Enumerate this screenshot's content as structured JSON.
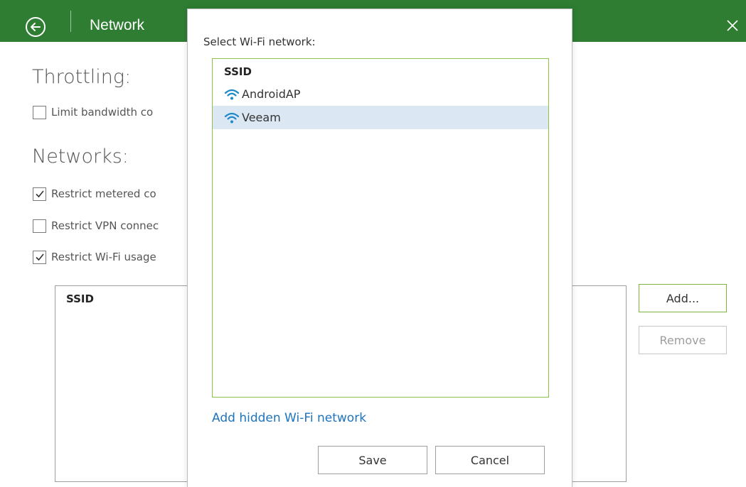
{
  "colors": {
    "header_bg": "#2e7d32",
    "accent_border": "#8bc34a",
    "selection": "#dbe8f3",
    "link": "#1e73be",
    "wifi_icon": "#1e88c9"
  },
  "header": {
    "back_icon": "arrow-left-circle-icon",
    "title": "Network",
    "close_icon": "close-icon"
  },
  "settings": {
    "throttling_title": "Throttling:",
    "limit_bandwidth_label": "Limit bandwidth co",
    "limit_bandwidth_checked": false,
    "networks_title": "Networks:",
    "restrict_metered_label": "Restrict metered co",
    "restrict_metered_checked": true,
    "restrict_vpn_label": "Restrict VPN connec",
    "restrict_vpn_checked": false,
    "restrict_wifi_label": "Restrict Wi-Fi usage",
    "restrict_wifi_checked": true,
    "ssid_column": "SSID",
    "add_button": "Add...",
    "remove_button": "Remove"
  },
  "dialog": {
    "select_label": "Select Wi-Fi network:",
    "list_header": "SSID",
    "networks": [
      {
        "name": "AndroidAP",
        "icon": "wifi-icon",
        "selected": false
      },
      {
        "name": "Veeam",
        "icon": "wifi-icon",
        "selected": true
      }
    ],
    "add_hidden_link": "Add hidden Wi-Fi network",
    "save_button": "Save",
    "cancel_button": "Cancel"
  }
}
